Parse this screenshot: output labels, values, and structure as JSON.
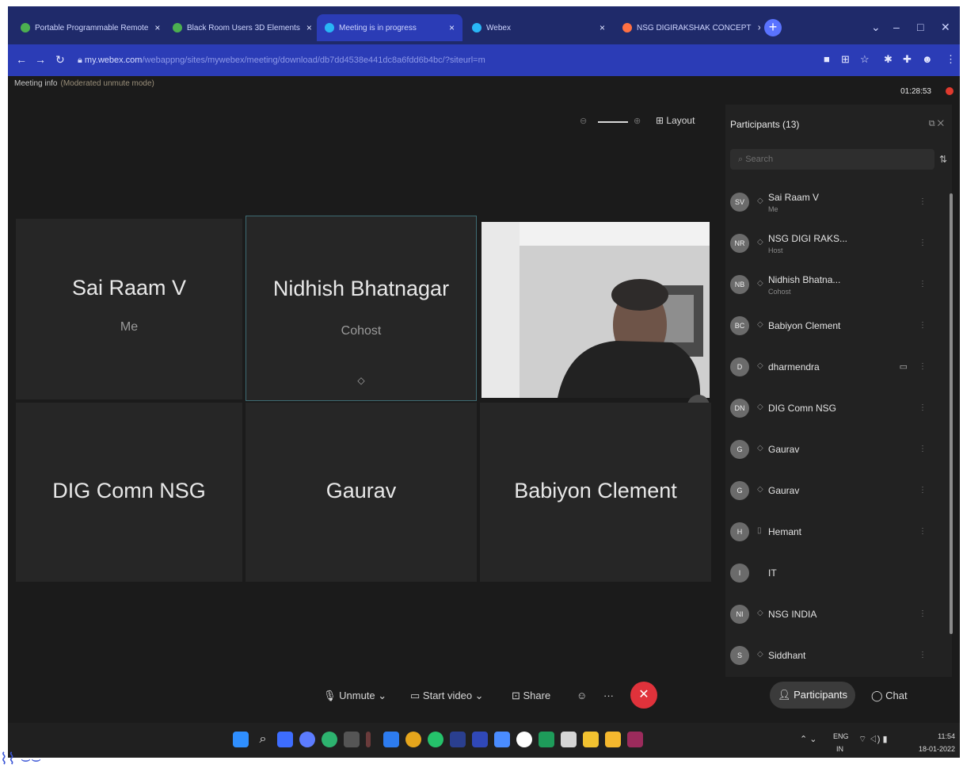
{
  "browser": {
    "tabs": [
      {
        "label": "Portable Programmable Remote",
        "icon_color": "#4caf50"
      },
      {
        "label": "Black Room Users 3D Elements",
        "icon_color": "#4caf50"
      },
      {
        "label": "Meeting is in progress",
        "icon_color": "#29b6f6"
      },
      {
        "label": "Webex",
        "icon_color": "#29b6f6"
      },
      {
        "label": "NSG DIGIRAKSHAK CONCEPT",
        "icon_color": "#ff7043"
      }
    ],
    "url_host": "my.webex.com",
    "url_path": "/webappng/sites/mywebex/meeting/download/db7dd4538e441dc8a6fdd6b4bc/?siteurl=m"
  },
  "meeting": {
    "info_label": "Meeting info",
    "info_sub": "(Moderated unmute mode)",
    "timer": "01:28:53",
    "layout_label": "Layout"
  },
  "grid": {
    "tiles": [
      {
        "name": "Sai Raam V",
        "role": "Me"
      },
      {
        "name": "Nidhish Bhatnagar",
        "role": "Cohost"
      },
      {
        "name": "DIG Comn NSG",
        "role": ""
      },
      {
        "name": "Gaurav",
        "role": ""
      },
      {
        "name": "Babiyon Clement",
        "role": ""
      }
    ]
  },
  "participants": {
    "title": "Participants (13)",
    "search_placeholder": "Search",
    "list": [
      {
        "initials": "SV",
        "name": "Sai Raam V",
        "role": "Me"
      },
      {
        "initials": "NR",
        "name": "NSG DIGI RAKS...",
        "role": "Host"
      },
      {
        "initials": "NB",
        "name": "Nidhish Bhatna...",
        "role": "Cohost"
      },
      {
        "initials": "BC",
        "name": "Babiyon Clement",
        "role": ""
      },
      {
        "initials": "D",
        "name": "dharmendra",
        "role": ""
      },
      {
        "initials": "DN",
        "name": "DIG Comn NSG",
        "role": ""
      },
      {
        "initials": "G",
        "name": "Gaurav",
        "role": ""
      },
      {
        "initials": "G",
        "name": "Gaurav",
        "role": ""
      },
      {
        "initials": "H",
        "name": "Hemant",
        "role": ""
      },
      {
        "initials": "I",
        "name": "IT",
        "role": ""
      },
      {
        "initials": "NI",
        "name": "NSG INDIA",
        "role": ""
      },
      {
        "initials": "S",
        "name": "Siddhant",
        "role": ""
      }
    ]
  },
  "controls": {
    "unmute": "Unmute",
    "start_video": "Start video",
    "share": "Share",
    "participants": "Participants",
    "chat": "Chat"
  },
  "taskbar": {
    "lang_top": "ENG",
    "lang_bottom": "IN",
    "time": "11:54",
    "date": "18-01-2022"
  }
}
